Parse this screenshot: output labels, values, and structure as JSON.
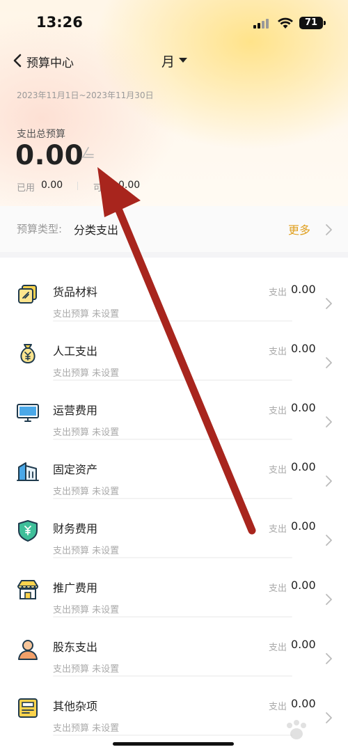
{
  "status_bar": {
    "time": "13:26",
    "battery": "71"
  },
  "nav": {
    "back_label": "预算中心",
    "period": "月"
  },
  "summary": {
    "date_range": "2023年11月1日~2023年11月30日",
    "total_label": "支出总预算",
    "total_value": "0.00",
    "used_label": "已用",
    "used_value": "0.00",
    "available_label": "可",
    "available_value": "0.00"
  },
  "budget_type": {
    "label": "预算类型:",
    "value": "分类支出",
    "more": "更多"
  },
  "categories": [
    {
      "name": "货品材料",
      "sub": "支出预算  未设置",
      "spend_label": "支出",
      "spend_value": "0.00",
      "icon": "goods-materials-icon"
    },
    {
      "name": "人工支出",
      "sub": "支出预算  未设置",
      "spend_label": "支出",
      "spend_value": "0.00",
      "icon": "money-bag-icon"
    },
    {
      "name": "运营费用",
      "sub": "支出预算  未设置",
      "spend_label": "支出",
      "spend_value": "0.00",
      "icon": "monitor-icon"
    },
    {
      "name": "固定资产",
      "sub": "支出预算  未设置",
      "spend_label": "支出",
      "spend_value": "0.00",
      "icon": "building-icon"
    },
    {
      "name": "财务费用",
      "sub": "支出预算  未设置",
      "spend_label": "支出",
      "spend_value": "0.00",
      "icon": "shield-yen-icon"
    },
    {
      "name": "推广费用",
      "sub": "支出预算  未设置",
      "spend_label": "支出",
      "spend_value": "0.00",
      "icon": "storefront-icon"
    },
    {
      "name": "股东支出",
      "sub": "支出预算  未设置",
      "spend_label": "支出",
      "spend_value": "0.00",
      "icon": "person-icon"
    },
    {
      "name": "其他杂项",
      "sub": "支出预算  未设置",
      "spend_label": "支出",
      "spend_value": "0.00",
      "icon": "document-icon"
    }
  ],
  "colors": {
    "accent": "#e0a020",
    "icon_fill": "#fbd34d",
    "icon_stroke": "#1f3a4d",
    "icon_green": "#3fbf9a",
    "arrow": "#a8251d"
  }
}
